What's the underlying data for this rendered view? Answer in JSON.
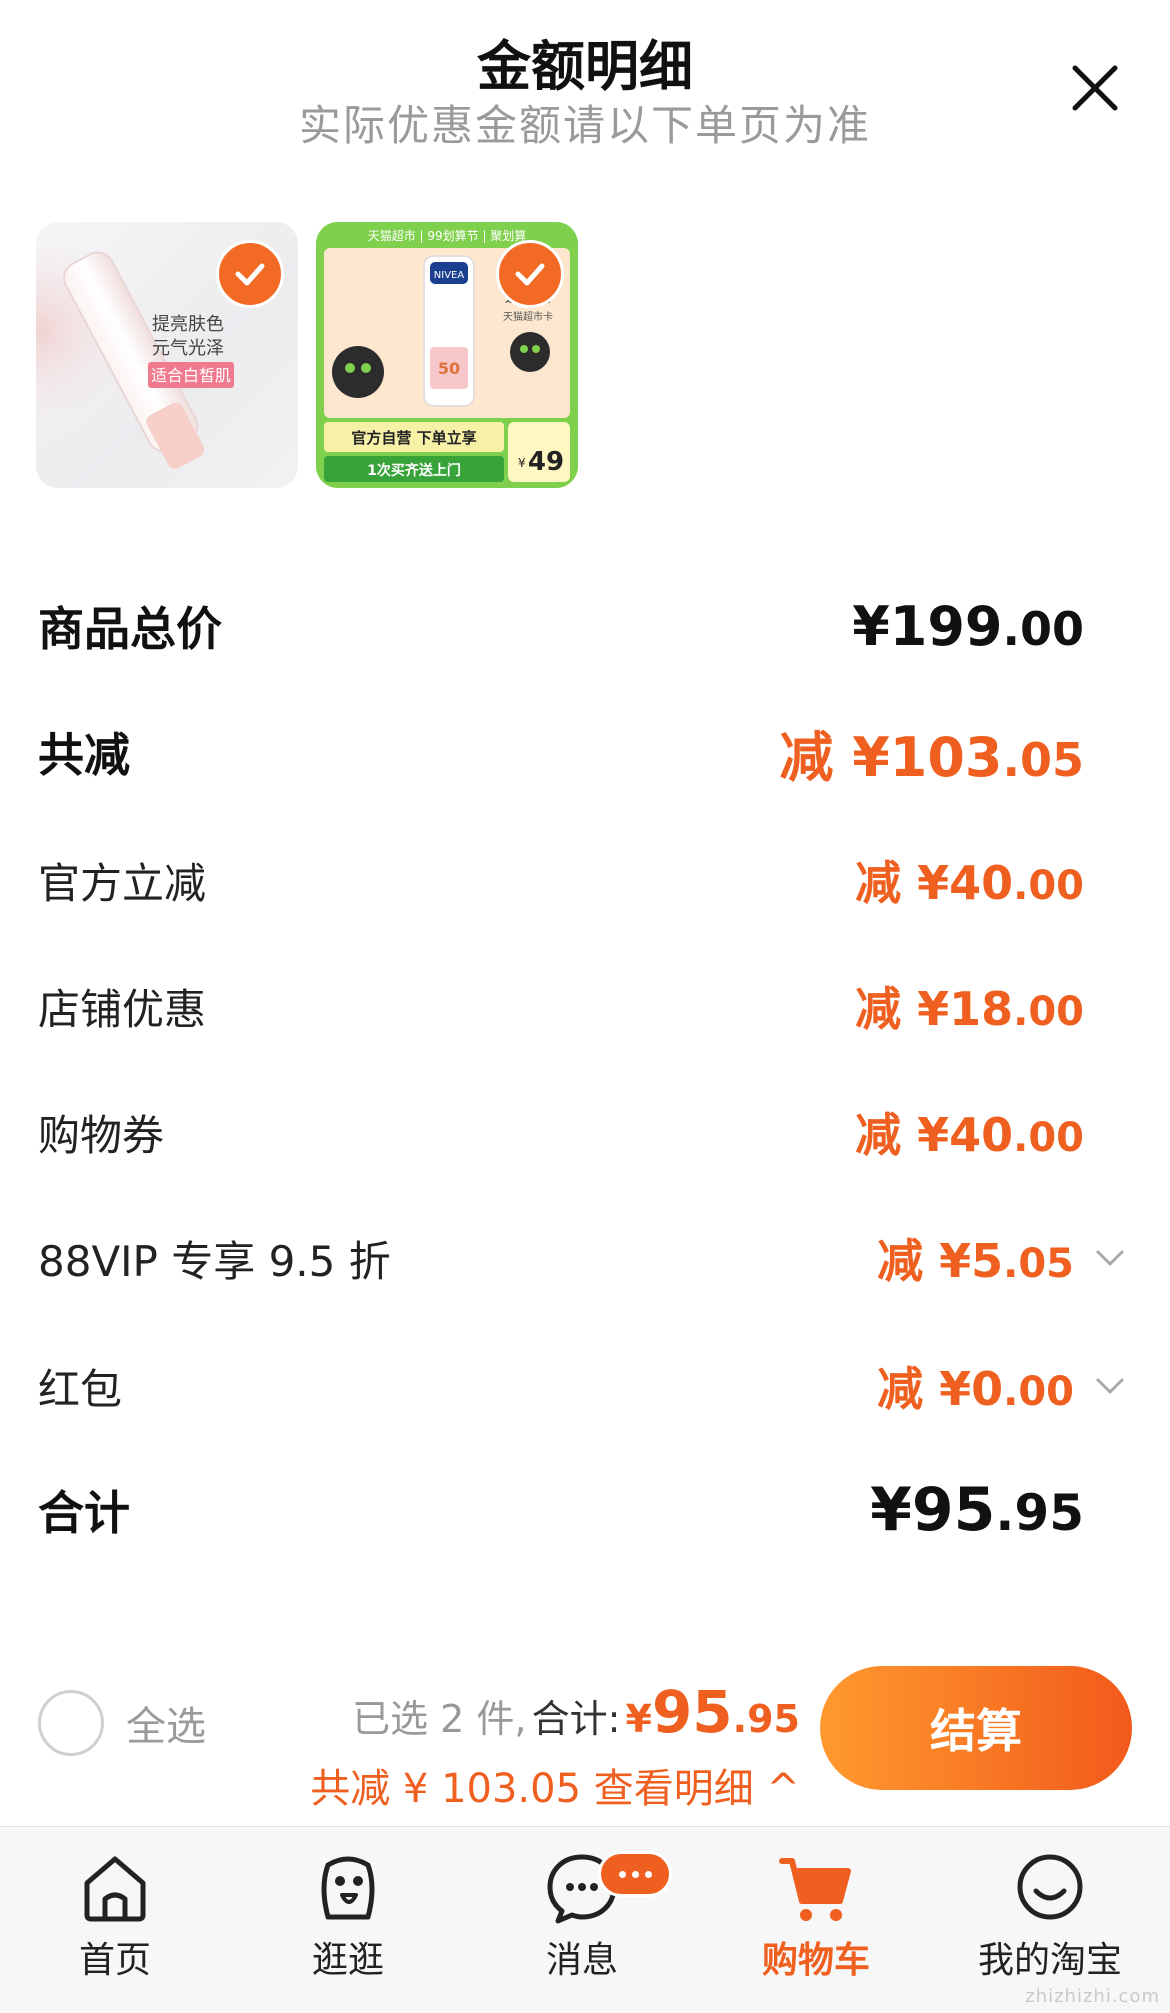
{
  "header": {
    "title": "金额明细",
    "subtitle": "实际优惠金额请以下单页为准"
  },
  "products": [
    {
      "lines": [
        "提亮肤色",
        "元气光泽"
      ],
      "tag": "适合白皙肌"
    },
    {
      "top_banner": "天猫超市 | 99划算节 | 聚划算",
      "brand": "NIVEA",
      "spf": "50",
      "rebate": "返12元",
      "rebate_note": "天猫超市卡",
      "promo1": "官方自营 下单立享",
      "promo2": "1次买齐送上门",
      "price_symbol": "¥",
      "price": "49"
    }
  ],
  "breakdown": {
    "total_label": "商品总价",
    "total_value": {
      "prefix": "",
      "int": "¥199",
      "dec": ".00"
    },
    "discount_label": "共减",
    "discount_value": {
      "prefix": "减 ",
      "int": "¥103",
      "dec": ".05"
    },
    "items": [
      {
        "label": "官方立减",
        "prefix": "减 ",
        "int": "¥40",
        "dec": ".00"
      },
      {
        "label": "店铺优惠",
        "prefix": "减 ",
        "int": "¥18",
        "dec": ".00"
      },
      {
        "label": "购物券",
        "prefix": "减 ",
        "int": "¥40",
        "dec": ".00"
      },
      {
        "label": "88VIP 专享 9.5 折",
        "prefix": "减 ",
        "int": "¥5",
        "dec": ".05"
      },
      {
        "label": "红包",
        "prefix": "减 ",
        "int": "¥0",
        "dec": ".00"
      }
    ],
    "sum_label": "合计",
    "sum_value": {
      "int": "¥95",
      "dec": ".95"
    }
  },
  "settle": {
    "select_all": "全选",
    "selected_text": "已选 2 件,",
    "total_text": "合计:",
    "price_symbol": "¥",
    "price_int": "95",
    "price_dec": ".95",
    "discount_text": "共减 ¥ 103.05 查看明细 ^",
    "checkout": "结算"
  },
  "tabs": [
    {
      "label": "首页",
      "icon": "home-icon"
    },
    {
      "label": "逛逛",
      "icon": "stroll-icon"
    },
    {
      "label": "消息",
      "icon": "message-icon"
    },
    {
      "label": "购物车",
      "icon": "cart-icon",
      "active": true
    },
    {
      "label": "我的淘宝",
      "icon": "profile-icon"
    }
  ],
  "watermark": "zhizhizhi.com",
  "colors": {
    "accent": "#ef5f20",
    "muted": "#9a9a9a"
  }
}
